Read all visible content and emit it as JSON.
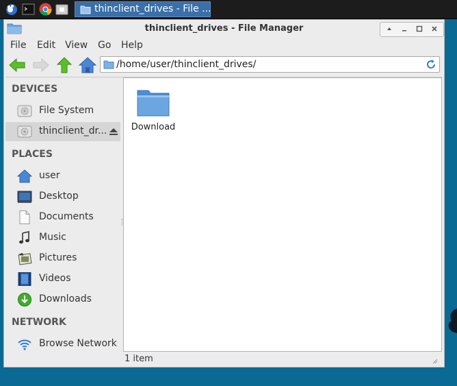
{
  "taskbar": {
    "task_title": "thinclient_drives - File ..."
  },
  "window": {
    "title": "thinclient_drives - File Manager",
    "controls": [
      "up",
      "minimize",
      "maximize",
      "close"
    ]
  },
  "menu": [
    "File",
    "Edit",
    "View",
    "Go",
    "Help"
  ],
  "toolbar": {
    "location": "/home/user/thinclient_drives/"
  },
  "sidebar": {
    "devices_heading": "DEVICES",
    "devices": [
      {
        "label": "File System",
        "icon": "drive-icon"
      },
      {
        "label": "thinclient_dr...",
        "icon": "drive-icon",
        "selected": true
      }
    ],
    "places_heading": "PLACES",
    "places": [
      {
        "label": "user",
        "icon": "home-icon"
      },
      {
        "label": "Desktop",
        "icon": "desktop-icon"
      },
      {
        "label": "Documents",
        "icon": "document-icon"
      },
      {
        "label": "Music",
        "icon": "music-icon"
      },
      {
        "label": "Pictures",
        "icon": "pictures-icon"
      },
      {
        "label": "Videos",
        "icon": "videos-icon"
      },
      {
        "label": "Downloads",
        "icon": "downloads-icon"
      }
    ],
    "network_heading": "NETWORK",
    "network": [
      {
        "label": "Browse Network",
        "icon": "network-icon"
      }
    ]
  },
  "content": {
    "items": [
      {
        "name": "Download",
        "icon": "folder-icon"
      }
    ]
  },
  "status": {
    "text": "1 item"
  },
  "colors": {
    "desktop": "#0a6a94",
    "task_active": "#3a6fa8",
    "folder": "#5d9bd6"
  }
}
